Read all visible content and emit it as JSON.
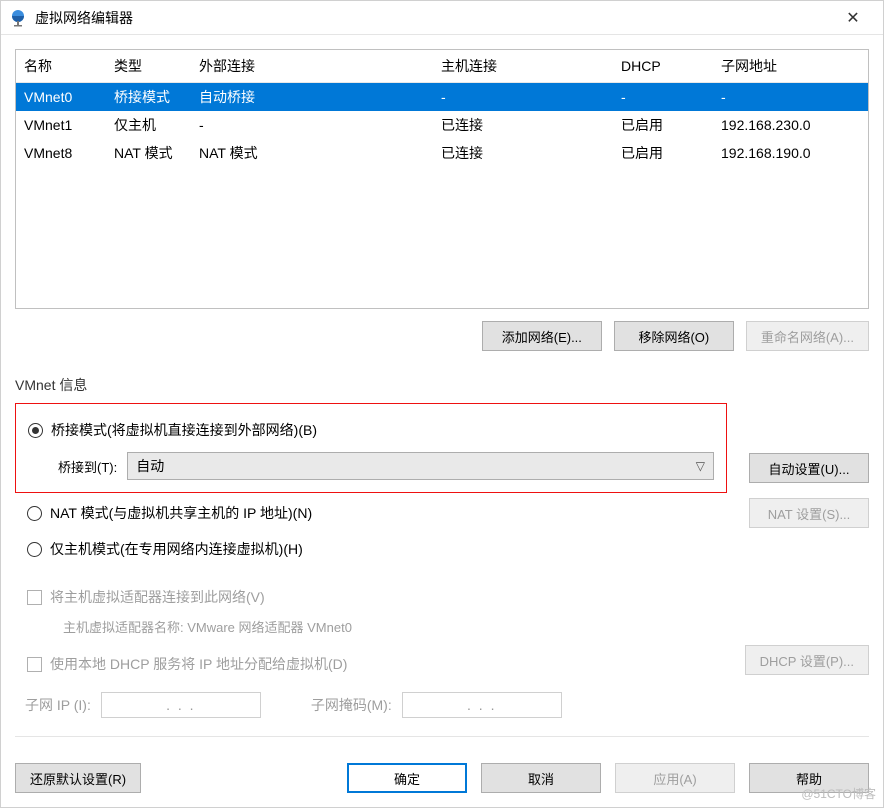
{
  "window": {
    "title": "虚拟网络编辑器"
  },
  "table": {
    "headers": {
      "name": "名称",
      "type": "类型",
      "external": "外部连接",
      "host": "主机连接",
      "dhcp": "DHCP",
      "subnet": "子网地址"
    },
    "rows": [
      {
        "name": "VMnet0",
        "type": "桥接模式",
        "external": "自动桥接",
        "host": "-",
        "dhcp": "-",
        "subnet": "-"
      },
      {
        "name": "VMnet1",
        "type": "仅主机",
        "external": "-",
        "host": "已连接",
        "dhcp": "已启用",
        "subnet": "192.168.230.0"
      },
      {
        "name": "VMnet8",
        "type": "NAT 模式",
        "external": "NAT 模式",
        "host": "已连接",
        "dhcp": "已启用",
        "subnet": "192.168.190.0"
      }
    ]
  },
  "buttons": {
    "add_network": "添加网络(E)...",
    "remove_network": "移除网络(O)",
    "rename_network": "重命名网络(A)...",
    "auto_settings": "自动设置(U)...",
    "nat_settings": "NAT 设置(S)...",
    "dhcp_settings": "DHCP 设置(P)...",
    "restore_defaults": "还原默认设置(R)",
    "ok": "确定",
    "cancel": "取消",
    "apply": "应用(A)",
    "help": "帮助"
  },
  "vmnet_info": {
    "legend": "VMnet 信息",
    "bridge_mode": "桥接模式(将虚拟机直接连接到外部网络)(B)",
    "bridge_to_label": "桥接到(T):",
    "bridge_to_value": "自动",
    "nat_mode": "NAT 模式(与虚拟机共享主机的 IP 地址)(N)",
    "host_only_mode": "仅主机模式(在专用网络内连接虚拟机)(H)",
    "connect_host_adapter": "将主机虚拟适配器连接到此网络(V)",
    "host_adapter_name": "主机虚拟适配器名称: VMware 网络适配器 VMnet0",
    "use_local_dhcp": "使用本地 DHCP 服务将 IP 地址分配给虚拟机(D)",
    "subnet_ip_label": "子网 IP (I):",
    "subnet_mask_label": "子网掩码(M):",
    "ip_placeholder": " .       .       . "
  },
  "watermark": "@51CTO博客"
}
